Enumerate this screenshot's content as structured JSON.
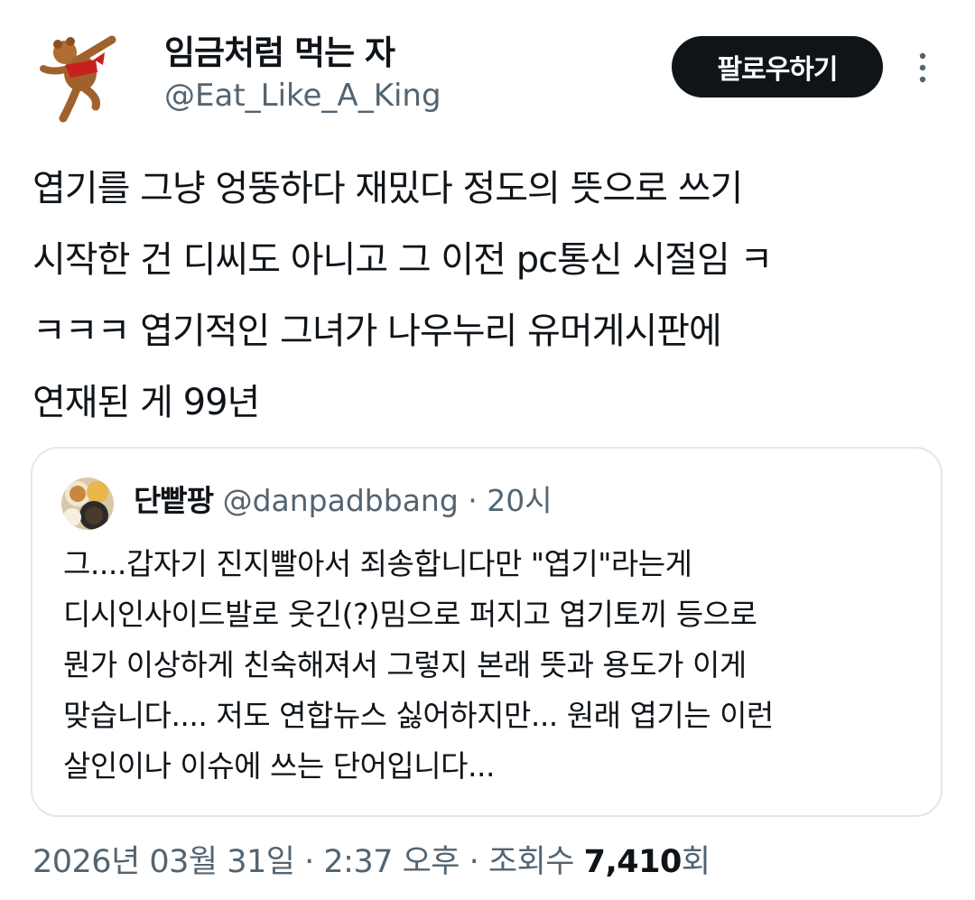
{
  "author": {
    "display_name": "임금처럼 먹는 자",
    "handle": "@Eat_Like_A_King",
    "avatar_icon": "dancing-bear-avatar"
  },
  "follow_button": {
    "label": "팔로우하기"
  },
  "more_icon": "more-vertical-icon",
  "tweet": {
    "lines": [
      "엽기를 그냥 엉뚱하다 재밌다 정도의 뜻으로 쓰기",
      "시작한 건 디씨도 아니고 그 이전 pc통신 시절임 ㅋ",
      "ㅋㅋㅋ 엽기적인 그녀가 나우누리 유머게시판에",
      "연재된 게 99년"
    ]
  },
  "quote": {
    "display_name": "단빹팡",
    "handle": "@danpadbbang",
    "separator": "·",
    "time": "20시",
    "avatar_icon": "food-photo-avatar",
    "lines": [
      "그....갑자기 진지빨아서 죄송합니다만 \"엽기\"라는게",
      "디시인사이드발로 웃긴(?)밈으로 퍼지고 엽기토끼 등으로",
      "뭔가 이상하게 친숙해져서 그렇지 본래 뜻과 용도가 이게",
      "맞습니다.... 저도 연합뉴스 싫어하지만... 원래 엽기는 이런",
      "살인이나 이슈에 쓰는 단어입니다..."
    ]
  },
  "meta": {
    "date": "2026년 03월 31일",
    "separator": " · ",
    "time": "2:37 오후",
    "views_label": "조회수 ",
    "views_count": "7,410",
    "views_suffix": "회"
  },
  "colors": {
    "text": "#0f1419",
    "secondary": "#536471",
    "border": "#e1e8ed",
    "button_bg": "#0f1419"
  }
}
